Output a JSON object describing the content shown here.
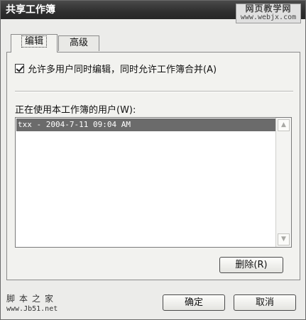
{
  "window": {
    "title": "共享工作簿"
  },
  "watermark": {
    "line1": "网页教学网",
    "line2": "www.webjx.com"
  },
  "tabs": [
    {
      "label": "编辑",
      "active": true
    },
    {
      "label": "高级",
      "active": false
    }
  ],
  "edit": {
    "allow_multi_user_label": "允许多用户同时编辑，同时允许工作簿合并(A)",
    "allow_multi_user_checked": true,
    "users_label": "正在使用本工作簿的用户(W):",
    "users": [
      "txx - 2004-7-11 09:04 AM"
    ],
    "delete_button": "删除(R)"
  },
  "footer": {
    "site_name": "脚本之家",
    "site_url": "www.Jb51.net",
    "ok_button": "确定",
    "cancel_button": "取消"
  },
  "icons": {
    "scroll_up": "scroll-up-arrow-icon",
    "scroll_down": "scroll-down-arrow-icon",
    "check": "checkmark-icon"
  }
}
